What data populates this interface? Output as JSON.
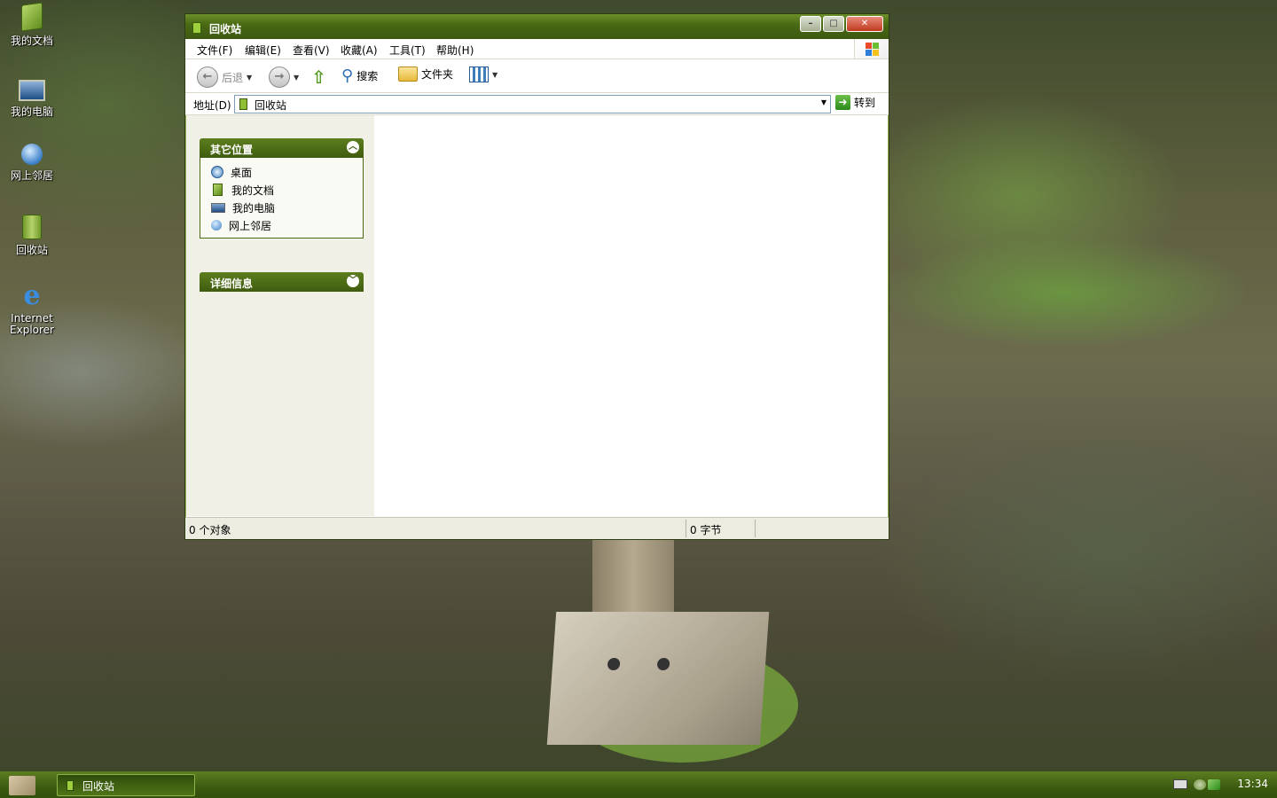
{
  "desktop": {
    "icons": [
      {
        "label": "我的文档",
        "icon": "my-documents-icon"
      },
      {
        "label": "我的电脑",
        "icon": "my-computer-icon"
      },
      {
        "label": "网上邻居",
        "icon": "network-places-icon"
      },
      {
        "label": "回收站",
        "icon": "recycle-bin-icon"
      },
      {
        "label": "Internet Explorer",
        "icon": "internet-explorer-icon"
      }
    ]
  },
  "window": {
    "title": "回收站",
    "menu": [
      "文件(F)",
      "编辑(E)",
      "查看(V)",
      "收藏(A)",
      "工具(T)",
      "帮助(H)"
    ],
    "toolbar": {
      "back": "后退",
      "search": "搜索",
      "folders": "文件夹"
    },
    "address": {
      "label": "地址(D)",
      "value": "回收站",
      "go": "转到"
    },
    "sidebar": {
      "other_places": {
        "title": "其它位置",
        "links": [
          "桌面",
          "我的文档",
          "我的电脑",
          "网上邻居"
        ]
      },
      "details": {
        "title": "详细信息"
      }
    },
    "status": {
      "objects": "0 个对象",
      "bytes": "0 字节"
    }
  },
  "taskbar": {
    "task": "回收站",
    "clock": "13:34"
  },
  "colors": {
    "accent": "#4a6a14",
    "taskbar": "#3d5a10"
  }
}
